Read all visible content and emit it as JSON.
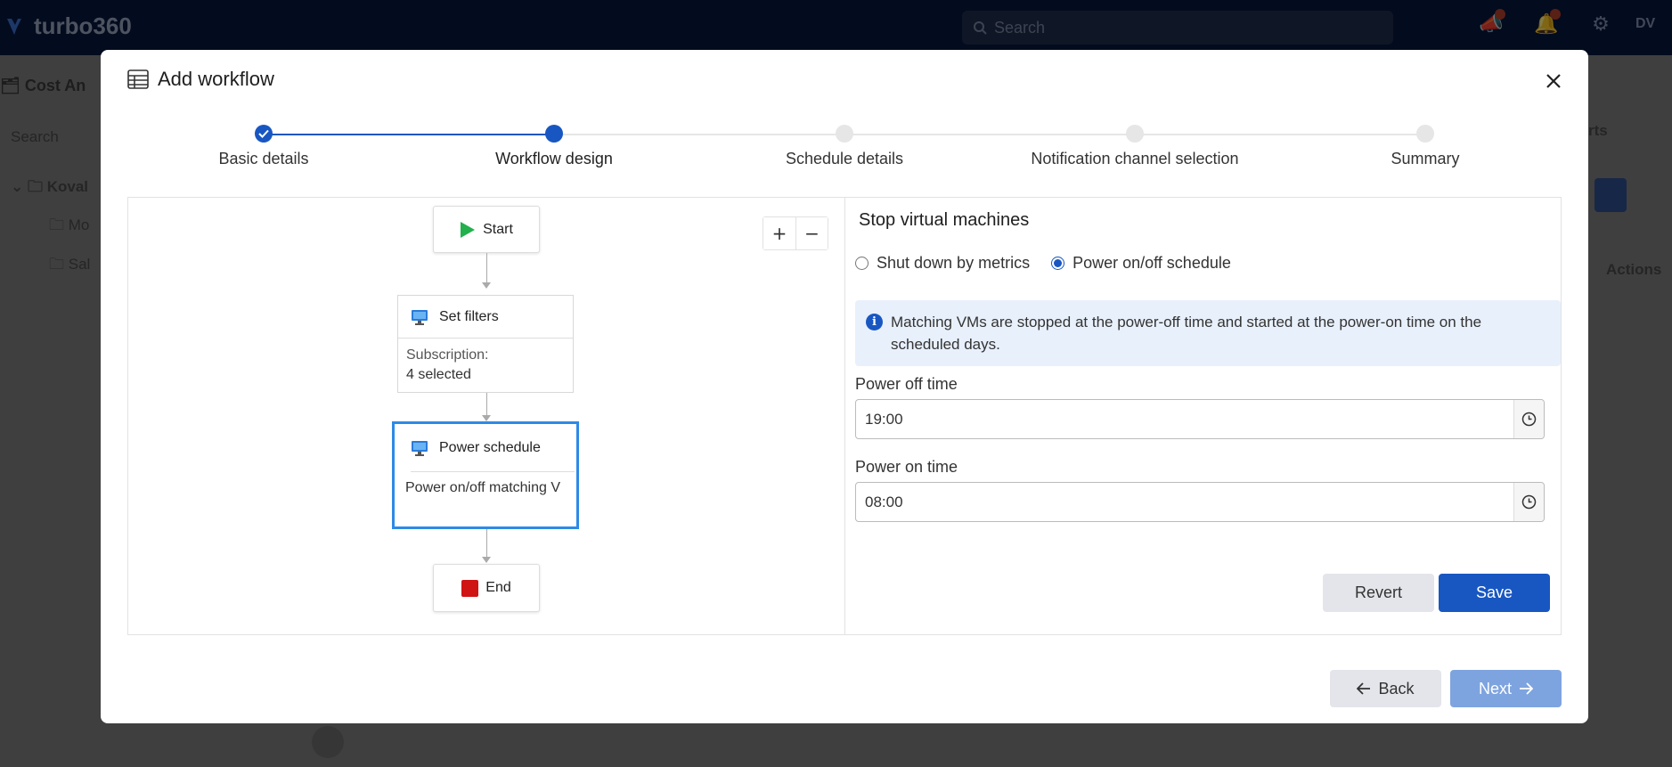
{
  "app": {
    "name": "turbo360",
    "search_placeholder": "Search",
    "user_initials": "DV",
    "bg_breadcrumb": "Cost An",
    "bg_search": "Search",
    "bg_tree": [
      "Koval",
      "Mo",
      "Sal"
    ],
    "bg_actions": "Actions",
    "bg_tab": "rts"
  },
  "modal": {
    "title": "Add workflow",
    "steps": [
      {
        "label": "Basic details",
        "state": "done"
      },
      {
        "label": "Workflow design",
        "state": "active"
      },
      {
        "label": "Schedule details",
        "state": "pending"
      },
      {
        "label": "Notification channel selection",
        "state": "pending"
      },
      {
        "label": "Summary",
        "state": "pending"
      }
    ]
  },
  "canvas": {
    "zoom_in": "+",
    "zoom_out": "−",
    "start_label": "Start",
    "end_label": "End",
    "filters": {
      "title": "Set filters",
      "field_label": "Subscription:",
      "field_value": "4 selected"
    },
    "power_schedule": {
      "title": "Power schedule",
      "description": "Power on/off matching V"
    }
  },
  "props": {
    "title": "Stop virtual machines",
    "radio_metrics": "Shut down by metrics",
    "radio_schedule": "Power on/off schedule",
    "info": "Matching VMs are stopped at the power-off time and started at the power-on time on the scheduled days.",
    "power_off_label": "Power off time",
    "power_off_value": "19:00",
    "power_on_label": "Power on time",
    "power_on_value": "08:00",
    "revert_label": "Revert",
    "save_label": "Save"
  },
  "footer": {
    "back_label": "Back",
    "next_label": "Next"
  },
  "colors": {
    "primary": "#1857c2",
    "selected_border": "#2d8ae6",
    "start_green": "#22b14c",
    "end_red": "#d01313",
    "navbar": "#06163d"
  }
}
